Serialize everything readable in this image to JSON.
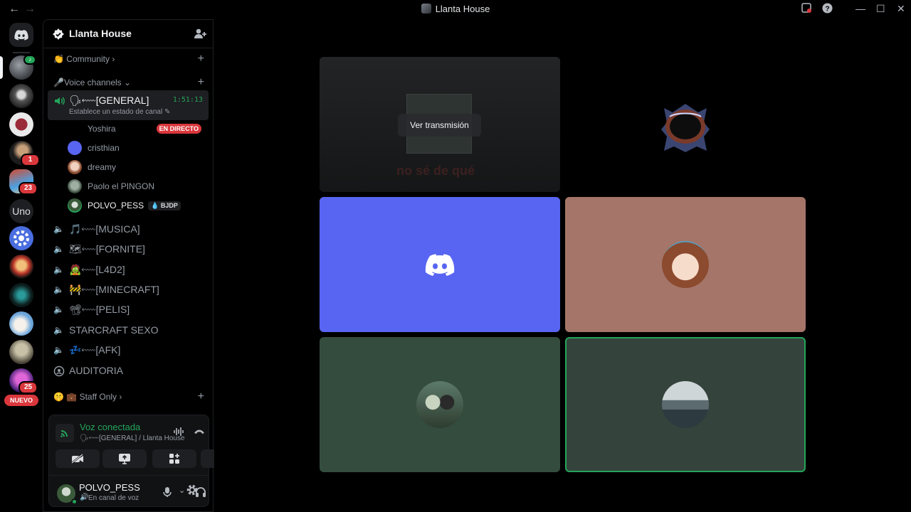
{
  "window": {
    "title": "Llanta House"
  },
  "rail": {
    "badges": {
      "server4": "1",
      "server5": "23",
      "server12": "25"
    },
    "uno_label": "Uno",
    "nuevo_label": "NUEVO"
  },
  "sidebar": {
    "server_name": "Llanta House",
    "categories": {
      "community": "Community",
      "voice": "Voice channels",
      "staff": "💼 Staff Only"
    },
    "active_channel": {
      "label": "🗣⬳[GENERAL]",
      "timer": "1:51:13",
      "status": "Establece un estado de canal"
    },
    "voice_users": [
      {
        "name": "Yoshira",
        "live": "EN DIRECTO"
      },
      {
        "name": "cristhian"
      },
      {
        "name": "dreamy"
      },
      {
        "name": "Paolo el PINGON"
      },
      {
        "name": "POLVO_PESS",
        "tag": "BJDP"
      }
    ],
    "channels": [
      {
        "label": "🎵⬳[MUSICA]"
      },
      {
        "label": "🗺⬳[FORNITE]"
      },
      {
        "label": "🧟⬳[L4D2]"
      },
      {
        "label": "🚧⬳[MINECRAFT]"
      },
      {
        "label": "📽⬳[PELIS]"
      },
      {
        "label": "STARCRAFT SEXO"
      },
      {
        "label": "💤⬳[AFK]"
      },
      {
        "label": "AUDITORIA"
      }
    ]
  },
  "voice_panel": {
    "title": "Voz conectada",
    "subtitle": "🗣⬳[GENERAL] / Llanta House"
  },
  "user_panel": {
    "name": "POLVO_PESS",
    "status": "En canal de voz"
  },
  "stage": {
    "watch_button": "Ver transmisión",
    "stream_caption": "no sé de qué"
  },
  "colors": {
    "blurple": "#5865f2",
    "green": "#23a55a",
    "red": "#da373c",
    "tile_rose": "#a47568",
    "tile_green": "#334c3e",
    "tile_slate": "#34433c"
  }
}
